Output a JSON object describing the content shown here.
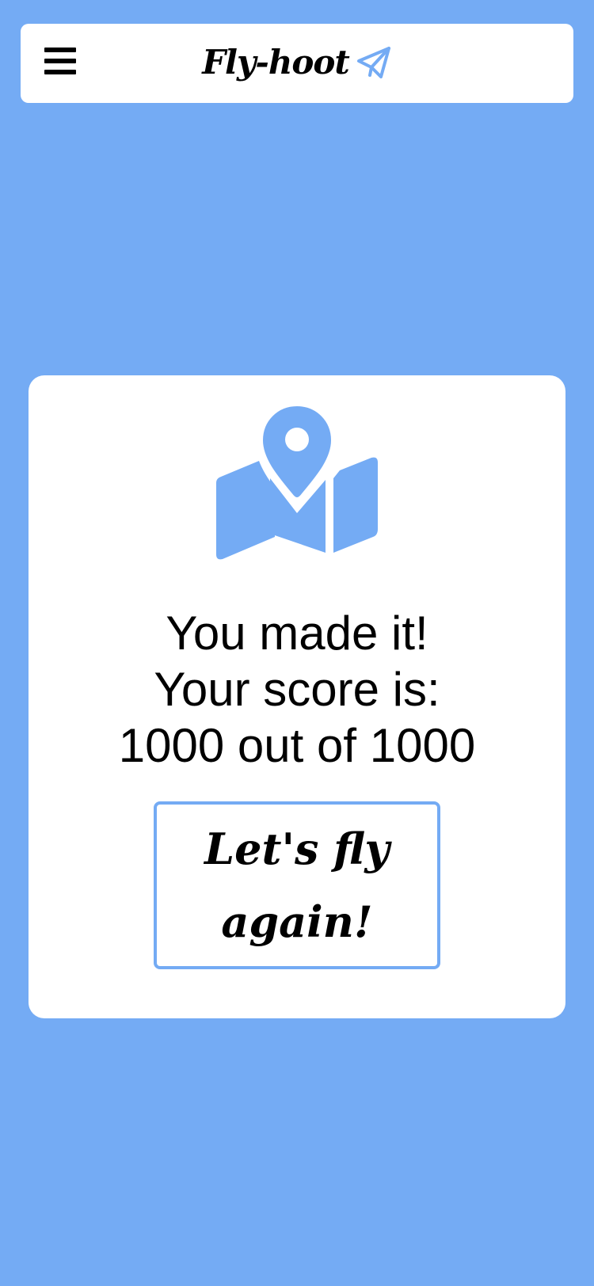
{
  "navbar": {
    "menu_icon": "hamburger-menu-icon",
    "brand_text": "Fly-hoot",
    "brand_icon": "paper-plane-icon"
  },
  "result": {
    "icon": "map-location-pin-icon",
    "line1": "You made it!",
    "line2": "Your score is:",
    "line3": "1000 out of 1000",
    "score": 1000,
    "max_score": 1000,
    "again_button_label": "Let's fly again!"
  },
  "colors": {
    "background": "#74abf4",
    "accent": "#74abf4",
    "surface": "#ffffff",
    "text": "#000000"
  }
}
